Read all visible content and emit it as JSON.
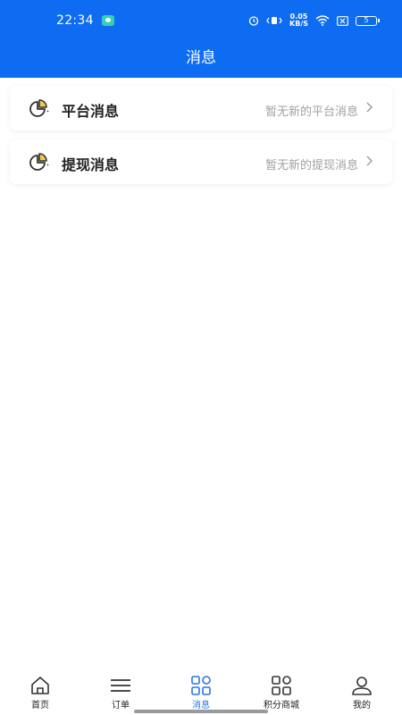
{
  "status_bar": {
    "time": "22:34",
    "net_speed_value": "0.05",
    "net_speed_unit": "KB/S",
    "battery": "5"
  },
  "header": {
    "title": "消息"
  },
  "messages": [
    {
      "title": "平台消息",
      "subtitle": "暂无新的平台消息"
    },
    {
      "title": "提现消息",
      "subtitle": "暂无新的提现消息"
    }
  ],
  "tabbar": {
    "items": [
      {
        "label": "首页",
        "icon": "home-icon"
      },
      {
        "label": "订单",
        "icon": "menu-icon"
      },
      {
        "label": "消息",
        "icon": "grid-icon",
        "active": true
      },
      {
        "label": "积分商城",
        "icon": "grid-icon"
      },
      {
        "label": "我的",
        "icon": "user-icon"
      }
    ]
  },
  "colors": {
    "header_bg": "#0d6cf2",
    "active_tab": "#2b73e6",
    "icon_accent": "#f5c84a"
  }
}
